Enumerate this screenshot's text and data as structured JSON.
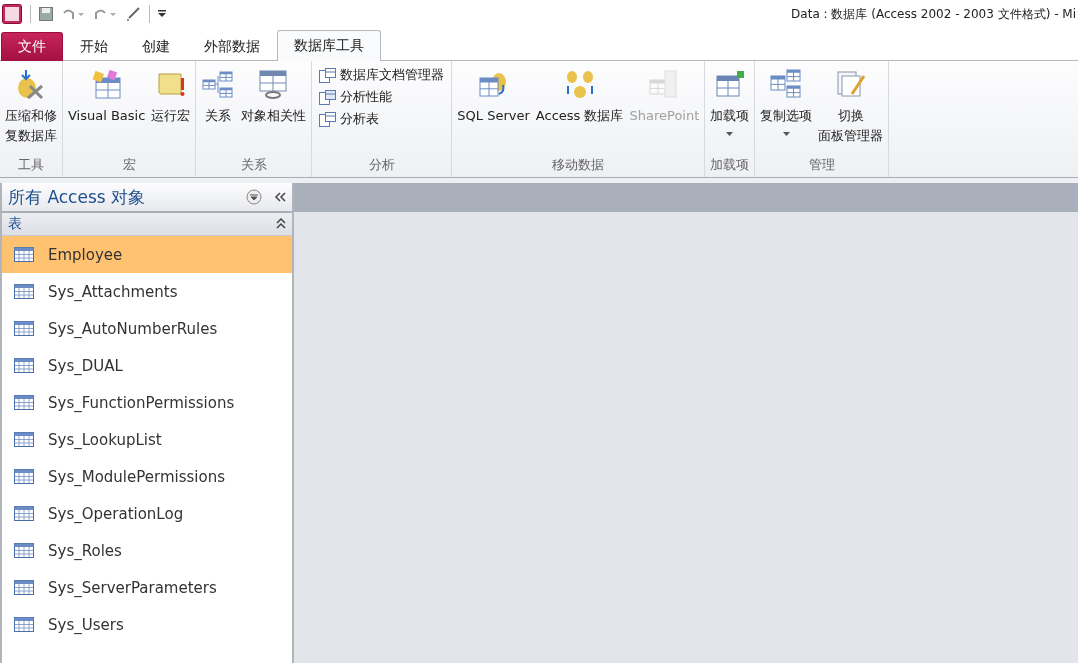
{
  "window": {
    "title": "Data : 数据库 (Access 2002 - 2003 文件格式)  -  Mi"
  },
  "tabs": [
    {
      "label": "文件",
      "kind": "file",
      "selected": false
    },
    {
      "label": "开始",
      "kind": "tab",
      "selected": false
    },
    {
      "label": "创建",
      "kind": "tab",
      "selected": false
    },
    {
      "label": "外部数据",
      "kind": "tab",
      "selected": false
    },
    {
      "label": "数据库工具",
      "kind": "tab",
      "selected": true
    }
  ],
  "ribbon": {
    "groups": [
      {
        "label": "工具",
        "buttons": [
          {
            "kind": "large",
            "lines": [
              "压缩和修",
              "复数据库"
            ],
            "disabled": false
          }
        ]
      },
      {
        "label": "宏",
        "buttons": [
          {
            "kind": "large",
            "lines": [
              "Visual Basic"
            ],
            "disabled": false
          },
          {
            "kind": "large",
            "lines": [
              "运行宏"
            ],
            "disabled": false
          }
        ]
      },
      {
        "label": "关系",
        "buttons": [
          {
            "kind": "large",
            "lines": [
              "关系"
            ],
            "disabled": false
          },
          {
            "kind": "large",
            "lines": [
              "对象相关性"
            ],
            "disabled": false
          }
        ]
      },
      {
        "label": "分析",
        "buttons": [
          {
            "kind": "small",
            "lines": [
              "数据库文档管理器"
            ],
            "disabled": false
          },
          {
            "kind": "small",
            "lines": [
              "分析性能"
            ],
            "disabled": false
          },
          {
            "kind": "small",
            "lines": [
              "分析表"
            ],
            "disabled": false
          }
        ]
      },
      {
        "label": "移动数据",
        "buttons": [
          {
            "kind": "large",
            "lines": [
              "SQL Server"
            ],
            "disabled": false
          },
          {
            "kind": "large",
            "lines": [
              "Access 数据库"
            ],
            "disabled": false
          },
          {
            "kind": "large",
            "lines": [
              "SharePoint"
            ],
            "disabled": true
          }
        ]
      },
      {
        "label": "加载项",
        "buttons": [
          {
            "kind": "large",
            "lines": [
              "加载项"
            ],
            "disabled": false,
            "dropdown": true
          }
        ]
      },
      {
        "label": "管理",
        "buttons": [
          {
            "kind": "large",
            "lines": [
              "复制选项"
            ],
            "disabled": false,
            "dropdown": true
          },
          {
            "kind": "large",
            "lines": [
              "切换",
              "面板管理器"
            ],
            "disabled": false
          }
        ]
      }
    ]
  },
  "navigation": {
    "title": "所有 Access 对象",
    "section": {
      "label": "表",
      "expanded": true
    },
    "items": [
      {
        "label": "Employee",
        "selected": true
      },
      {
        "label": "Sys_Attachments",
        "selected": false
      },
      {
        "label": "Sys_AutoNumberRules",
        "selected": false
      },
      {
        "label": "Sys_DUAL",
        "selected": false
      },
      {
        "label": "Sys_FunctionPermissions",
        "selected": false
      },
      {
        "label": "Sys_LookupList",
        "selected": false
      },
      {
        "label": "Sys_ModulePermissions",
        "selected": false
      },
      {
        "label": "Sys_OperationLog",
        "selected": false
      },
      {
        "label": "Sys_Roles",
        "selected": false
      },
      {
        "label": "Sys_ServerParameters",
        "selected": false
      },
      {
        "label": "Sys_Users",
        "selected": false
      }
    ]
  }
}
